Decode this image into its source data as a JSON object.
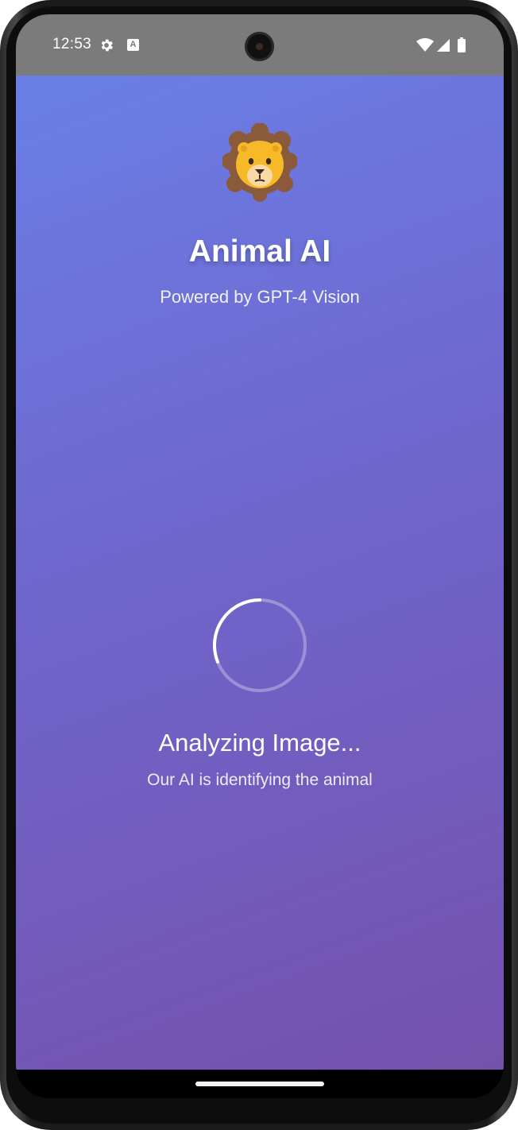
{
  "status_bar": {
    "time": "12:53",
    "icons": [
      "gear-icon",
      "a-icon",
      "wifi-icon",
      "signal-icon",
      "battery-icon"
    ]
  },
  "header": {
    "logo_icon": "lion-face-icon",
    "title": "Animal AI",
    "subtitle": "Powered by GPT-4 Vision"
  },
  "loading": {
    "spinner_icon": "loading-spinner-icon",
    "title": "Analyzing Image...",
    "subtitle": "Our AI is identifying the animal"
  },
  "colors": {
    "gradient_start": "#6a7fe6",
    "gradient_end": "#7551ad",
    "status_bar": "#7b7b7b"
  }
}
